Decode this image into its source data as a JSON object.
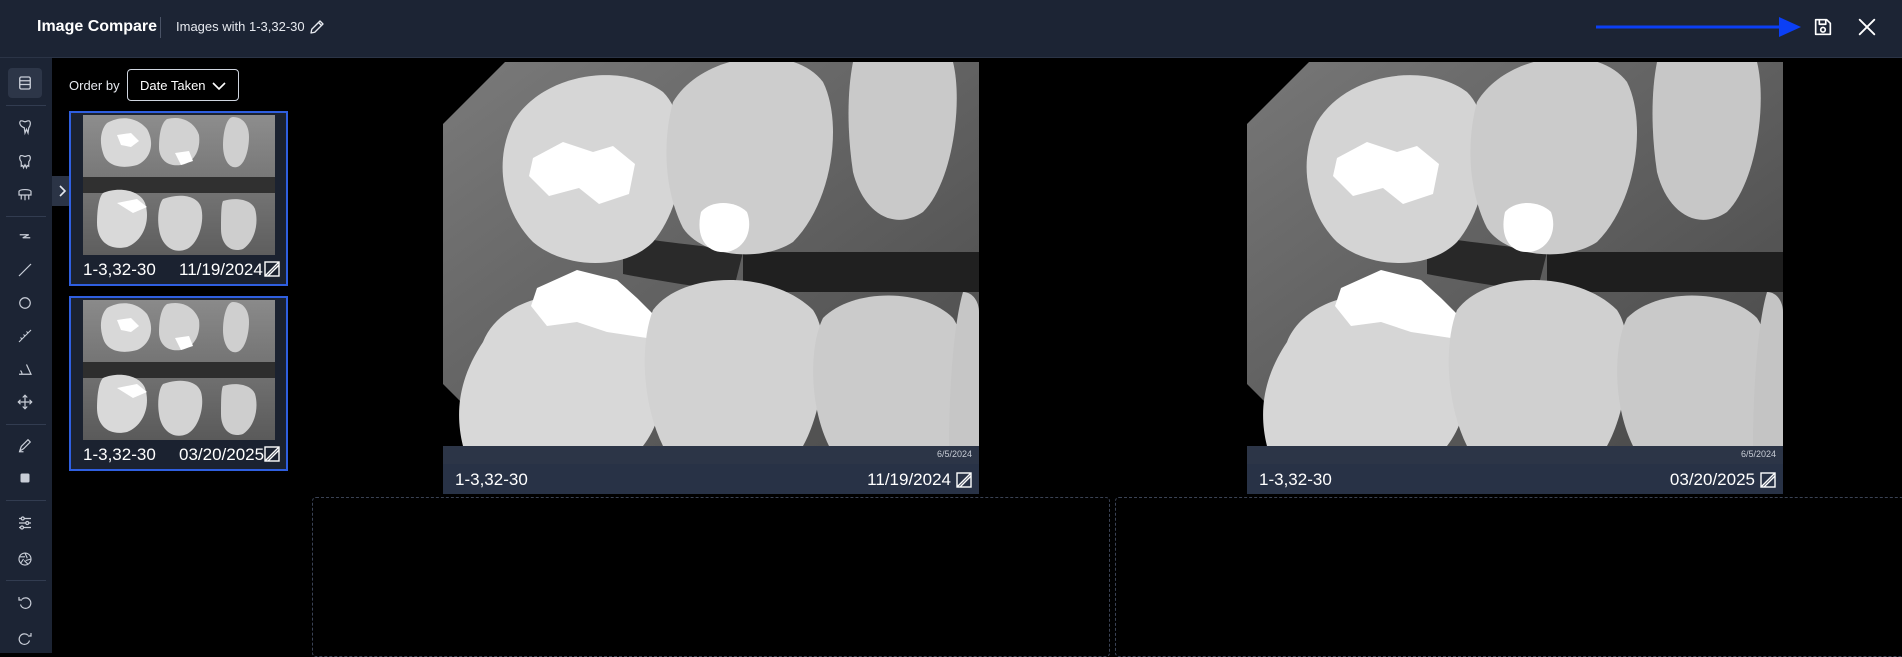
{
  "header": {
    "app_title": "Image Compare",
    "doc_title": "Images with 1-3,32-30",
    "arrow_color": "#0b3ff5"
  },
  "icons": {
    "edit": "pencil-icon",
    "save": "save-icon",
    "close": "close-icon"
  },
  "toolbar": {
    "tools": [
      "image-list-icon",
      "tooth-icon",
      "tooth-outline-icon",
      "teeth-icon",
      "lightning-icon",
      "line-icon",
      "circle-icon",
      "ruler-icon",
      "angle-icon",
      "move-icon",
      "pen-icon",
      "square-icon",
      "sliders-icon",
      "aperture-icon",
      "undo-icon",
      "redo-icon"
    ]
  },
  "sidebar": {
    "order_label": "Order by",
    "order_value": "Date Taken",
    "thumbnails": [
      {
        "label": "1-3,32-30",
        "date": "11/19/2024"
      },
      {
        "label": "1-3,32-30",
        "date": "03/20/2025"
      }
    ]
  },
  "viewers": [
    {
      "label": "1-3,32-30",
      "date": "11/19/2024",
      "stamp": "6/5/2024"
    },
    {
      "label": "1-3,32-30",
      "date": "03/20/2025",
      "stamp": "6/5/2024"
    }
  ],
  "colors": {
    "selection": "#2f5fe0",
    "header_bg": "#1c2434"
  }
}
